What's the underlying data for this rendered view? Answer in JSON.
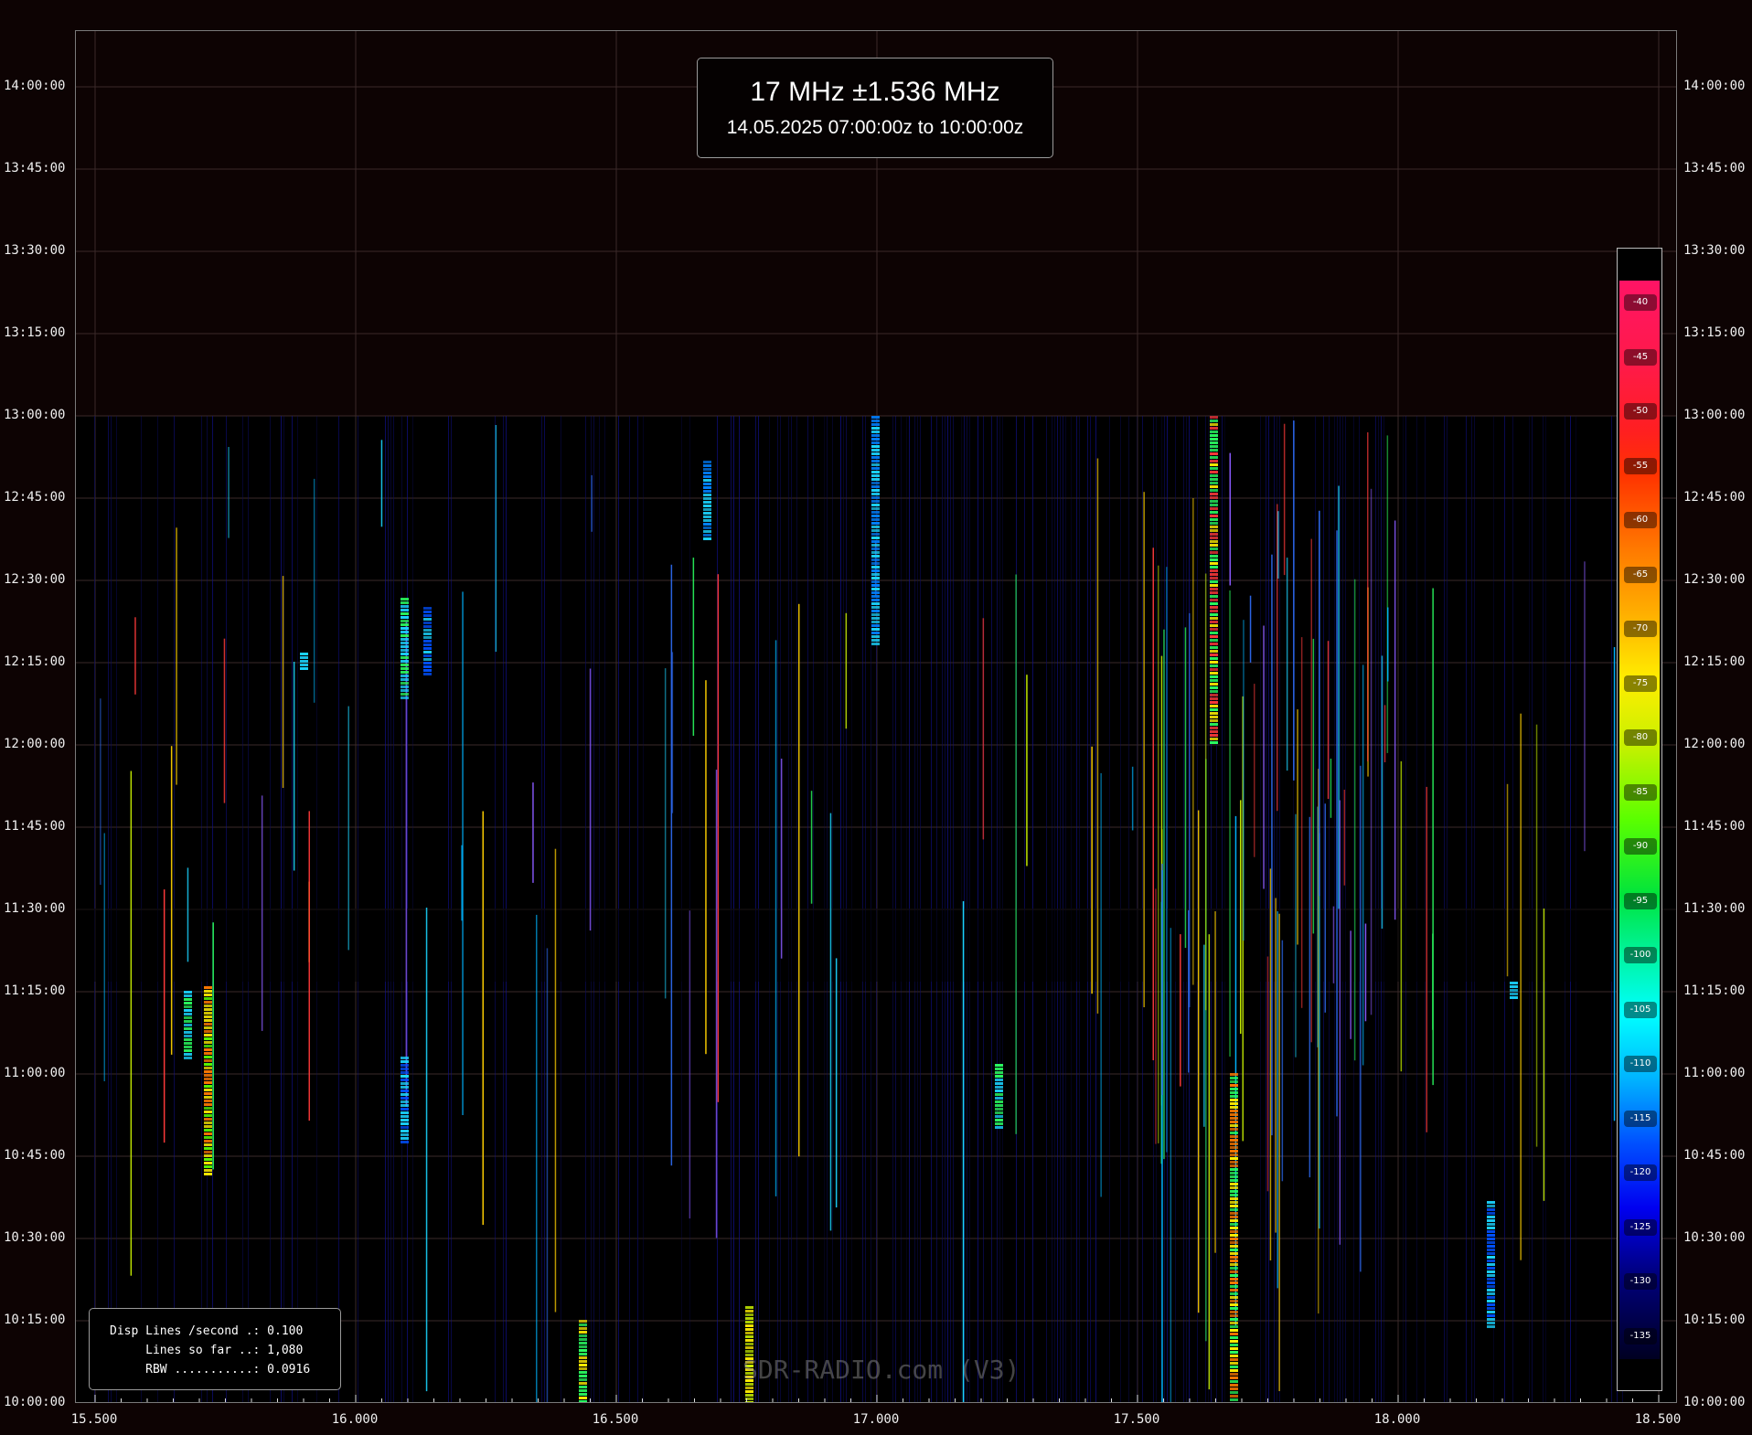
{
  "title": {
    "main": "17 MHz ±1.536 MHz",
    "sub": "14.05.2025 07:00:00z to 10:00:00z"
  },
  "y_axis_labels": [
    "14:00:00",
    "13:45:00",
    "13:30:00",
    "13:15:00",
    "13:00:00",
    "12:45:00",
    "12:30:00",
    "12:15:00",
    "12:00:00",
    "11:45:00",
    "11:30:00",
    "11:15:00",
    "11:00:00",
    "10:45:00",
    "10:30:00",
    "10:15:00",
    "10:00:00"
  ],
  "x_axis_labels": [
    "15.500",
    "16.000",
    "16.500",
    "17.000",
    "17.500",
    "18.000",
    "18.500"
  ],
  "colorbar_ticks": [
    "-40",
    "-45",
    "-50",
    "-55",
    "-60",
    "-65",
    "-70",
    "-75",
    "-80",
    "-85",
    "-90",
    "-95",
    "-100",
    "-105",
    "-110",
    "-115",
    "-120",
    "-125",
    "-130",
    "-135"
  ],
  "info": {
    "line1": "Disp Lines /second .: 0.100",
    "line2": "     Lines so far ..: 1,080",
    "line3": "     RBW ...........: 0.0916"
  },
  "watermark": "SDR-RADIO.com (V3)",
  "colors": {
    "background": "#0d0303",
    "grid": "#3a2a2a",
    "signal_low": "#0a0a60",
    "signal_high": "#ff1465"
  }
}
